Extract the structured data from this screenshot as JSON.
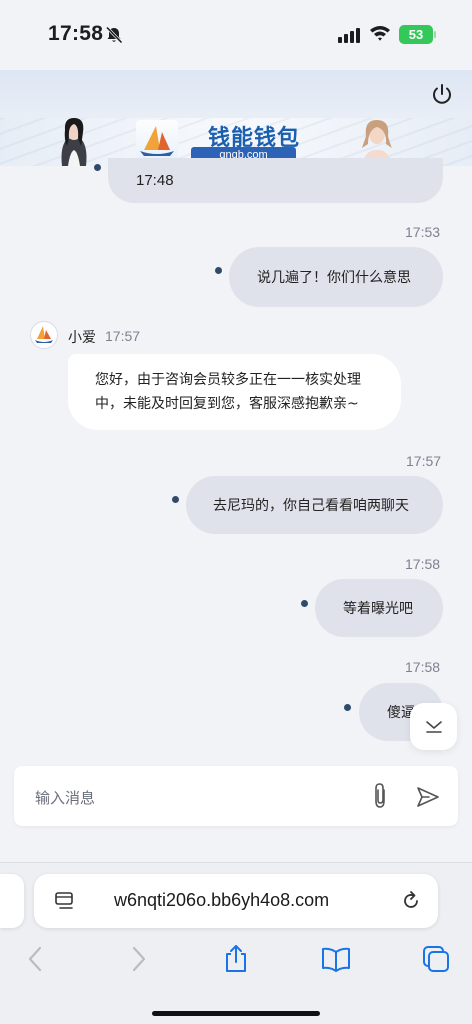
{
  "status_bar": {
    "time": "17:58",
    "battery": "53"
  },
  "banner": {
    "title": "钱能钱包",
    "url": "qnqb.com"
  },
  "messages": [
    {
      "type": "out",
      "text": "17:48"
    },
    {
      "type": "out",
      "time": "17:53",
      "text": "说几遍了！你们什么意思"
    },
    {
      "type": "in",
      "sender": "小爱",
      "time": "17:57",
      "text": "您好，由于咨询会员较多正在一一核实处理中，未能及时回复到您，客服深感抱歉亲~"
    },
    {
      "type": "out",
      "time": "17:57",
      "text": "去尼玛的，你自己看看咱两聊天"
    },
    {
      "type": "out",
      "time": "17:58",
      "text": "等着曝光吧"
    },
    {
      "type": "out",
      "time": "17:58",
      "text": "傻逼"
    }
  ],
  "input": {
    "placeholder": "输入消息"
  },
  "browser": {
    "url": "w6nqti206o.bb6yh4o8.com"
  },
  "colors": {
    "accent": "#304a6a",
    "bubble_out": "#dfe2ea",
    "bubble_in": "#ffffff",
    "background": "#f2f3f7",
    "link_blue": "#1a73e8"
  }
}
